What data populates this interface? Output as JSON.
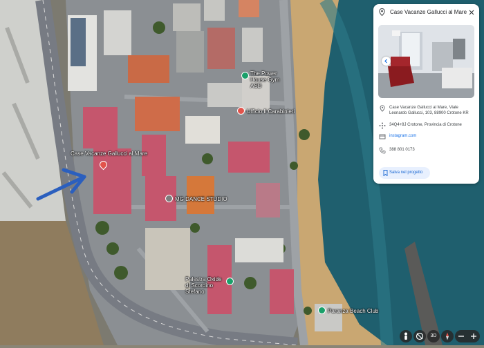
{
  "place_card": {
    "title": "Case Vacanze Gallucci al Mare",
    "address": "Case Vacanze Gallucci al Mare, Viale Leonardo Gallucci, 103, 88900 Crotone KR",
    "plus_code": "34Q4+8J Crotone, Provincia di Crotone",
    "website": "instagram.com",
    "phone": "388 801 0173",
    "save_label": "Salva nel progetto"
  },
  "map_labels": {
    "gym": "The Power House Gym ASD",
    "other_poi": "Ufficio Il Carabinieri",
    "hotel": "Case Vacanze Gallucci al Mare",
    "dance": "MG DANCE STUDIO",
    "palestra": "Palestra Oxide di Scordino Stefano",
    "beach_club": "Paranza Beach Club"
  },
  "controls": {
    "view_3d": "3D"
  },
  "colors": {
    "sea": "#1f5f6e",
    "sand": "#c9a772",
    "road": "#777b83",
    "roof_red": "#c5566d",
    "green_pin": "#1aa06a",
    "arrow": "#2b5fbe"
  }
}
